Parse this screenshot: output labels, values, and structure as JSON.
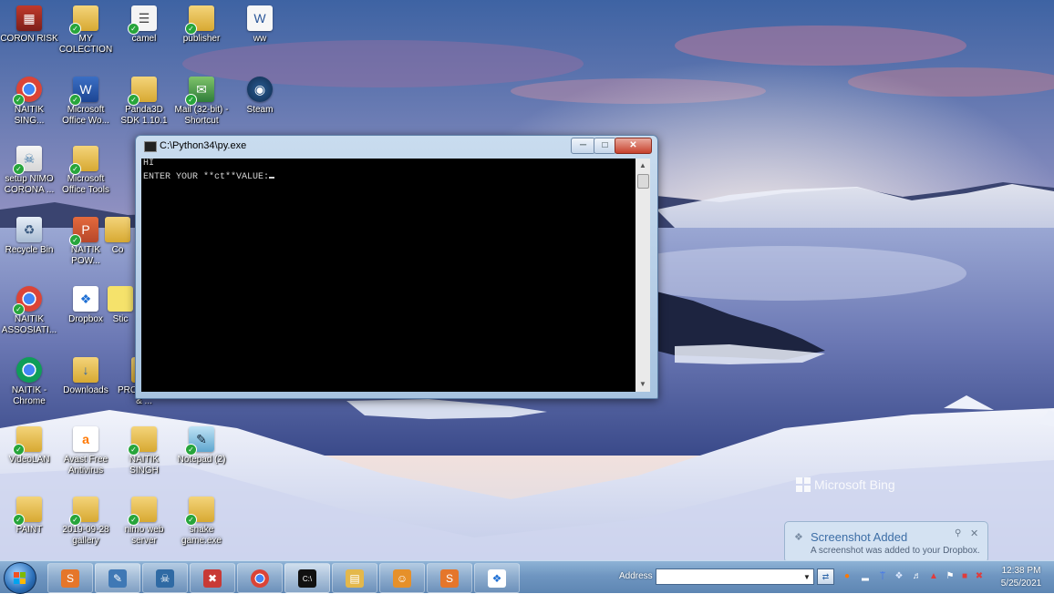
{
  "desktop": {
    "icons": [
      {
        "label": "CORON RISK",
        "icon": "winrar-icon"
      },
      {
        "label": "MY COLECTION",
        "icon": "folder-icon"
      },
      {
        "label": "camel",
        "icon": "document-icon"
      },
      {
        "label": "publisher",
        "icon": "folder-icon"
      },
      {
        "label": "ww",
        "icon": "word-document-icon"
      },
      {
        "label": "NAITIK SING...",
        "icon": "chrome-icon"
      },
      {
        "label": "Microsoft Office Wo...",
        "icon": "word-icon"
      },
      {
        "label": "Panda3D SDK 1.10.1",
        "icon": "folder-icon"
      },
      {
        "label": "Mail (32-bit) - Shortcut",
        "icon": "mail-icon"
      },
      {
        "label": "Steam",
        "icon": "steam-icon"
      },
      {
        "label": "setup NIMO CORONA ...",
        "icon": "python-setup-icon"
      },
      {
        "label": "Microsoft Office Tools",
        "icon": "folder-icon"
      },
      {
        "label": "Recycle Bin",
        "icon": "recycle-bin-icon"
      },
      {
        "label": "NAITIK POW...",
        "icon": "powerpoint-icon"
      },
      {
        "label": "Co",
        "icon": "folder-icon"
      },
      {
        "label": "NAITIK ASSOSIATI...",
        "icon": "chrome-icon"
      },
      {
        "label": "Dropbox",
        "icon": "dropbox-icon"
      },
      {
        "label": "Stic",
        "icon": "sticky-notes-icon"
      },
      {
        "label": "NAITIK - Chrome",
        "icon": "chrome-icon"
      },
      {
        "label": "Downloads",
        "icon": "downloads-folder-icon"
      },
      {
        "label": "PRO TOOLS & ...",
        "icon": "folder-icon"
      },
      {
        "label": "2",
        "icon": "folder-icon"
      },
      {
        "label": "VideoLAN",
        "icon": "folder-icon"
      },
      {
        "label": "Avast Free Antivirus",
        "icon": "avast-icon"
      },
      {
        "label": "NAITIK SINGH",
        "icon": "folder-icon"
      },
      {
        "label": "Notepad (2)",
        "icon": "notepad-icon"
      },
      {
        "label": "PAINT",
        "icon": "folder-icon"
      },
      {
        "label": "2019-09-28 gallery",
        "icon": "folder-icon"
      },
      {
        "label": "nimo web server",
        "icon": "folder-icon"
      },
      {
        "label": "snake game.exe",
        "icon": "folder-icon"
      }
    ]
  },
  "console": {
    "title": "C:\\Python34\\py.exe",
    "lines": [
      "HI",
      "ENTER YOUR **ct**VALUE:"
    ],
    "buttons": {
      "minimize": "─",
      "maximize": "□",
      "close": "✕"
    }
  },
  "watermark": {
    "text": "Microsoft Bing"
  },
  "notification": {
    "title": "Screenshot Added",
    "body": "A screenshot was added to your Dropbox."
  },
  "taskbar": {
    "apps": [
      {
        "icon": "sublime-text-icon",
        "color": "#e5762a"
      },
      {
        "icon": "python-idle-icon",
        "color": "#3f78b5"
      },
      {
        "icon": "python-icon",
        "color": "#2f6aa4"
      },
      {
        "icon": "app-red-icon",
        "color": "#c83a36"
      },
      {
        "icon": "chrome-icon",
        "color": "#d9432f"
      },
      {
        "icon": "console-icon",
        "color": "#111111"
      },
      {
        "icon": "file-explorer-icon",
        "color": "#e4b84b"
      },
      {
        "icon": "scratch-cat-icon",
        "color": "#e6902a"
      },
      {
        "icon": "sublime-text-icon",
        "color": "#e5762a"
      },
      {
        "icon": "dropbox-icon",
        "color": "#1f70d4"
      }
    ],
    "address_label": "Address",
    "address_value": "",
    "clock_time": "12:38 PM",
    "clock_date": "5/25/2021"
  },
  "tray": {
    "icons": [
      "avast-tray-icon",
      "network-tray-icon",
      "bluetooth-tray-icon",
      "dropbox-tray-icon",
      "volume-tray-icon",
      "shield-tray-icon",
      "flag-tray-icon",
      "usb-tray-icon",
      "network-warning-icon"
    ]
  }
}
